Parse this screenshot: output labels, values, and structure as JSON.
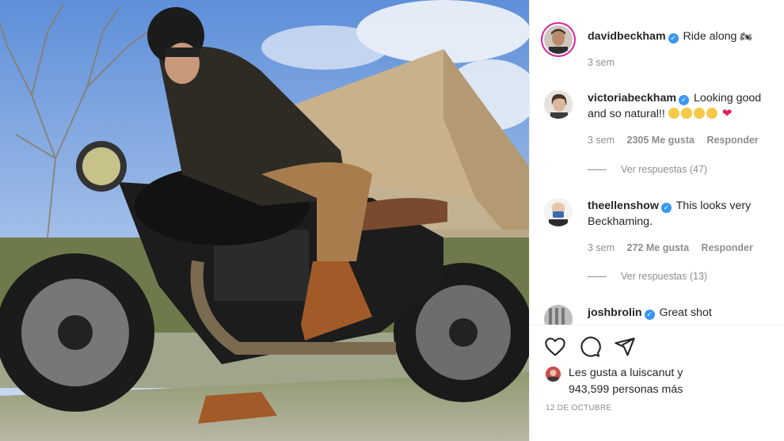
{
  "post": {
    "author": "davidbeckham",
    "caption": "Ride along",
    "caption_emoji": "🏍",
    "time": "3 sem"
  },
  "comments": [
    {
      "user": "victoriabeckham",
      "text": "Looking good and so natural!!",
      "time": "3 sem",
      "likes": "2305 Me gusta",
      "reply": "Responder",
      "view_replies": "Ver respuestas (47)"
    },
    {
      "user": "theellenshow",
      "text": "This looks very Beckhaming.",
      "time": "3 sem",
      "likes": "272 Me gusta",
      "reply": "Responder",
      "view_replies": "Ver respuestas (13)"
    },
    {
      "user": "joshbrolin",
      "text": "Great shot"
    }
  ],
  "liked_by": {
    "line1": "Les gusta a luiscanut y",
    "line2": "943,599 personas más"
  },
  "date": "12 DE OCTUBRE",
  "icons": [
    "heart-icon",
    "comment-icon",
    "share-icon"
  ],
  "colors": {
    "verified": "#3897f0",
    "secondary_text": "#8e8e8e",
    "heart": "#e0245e"
  }
}
